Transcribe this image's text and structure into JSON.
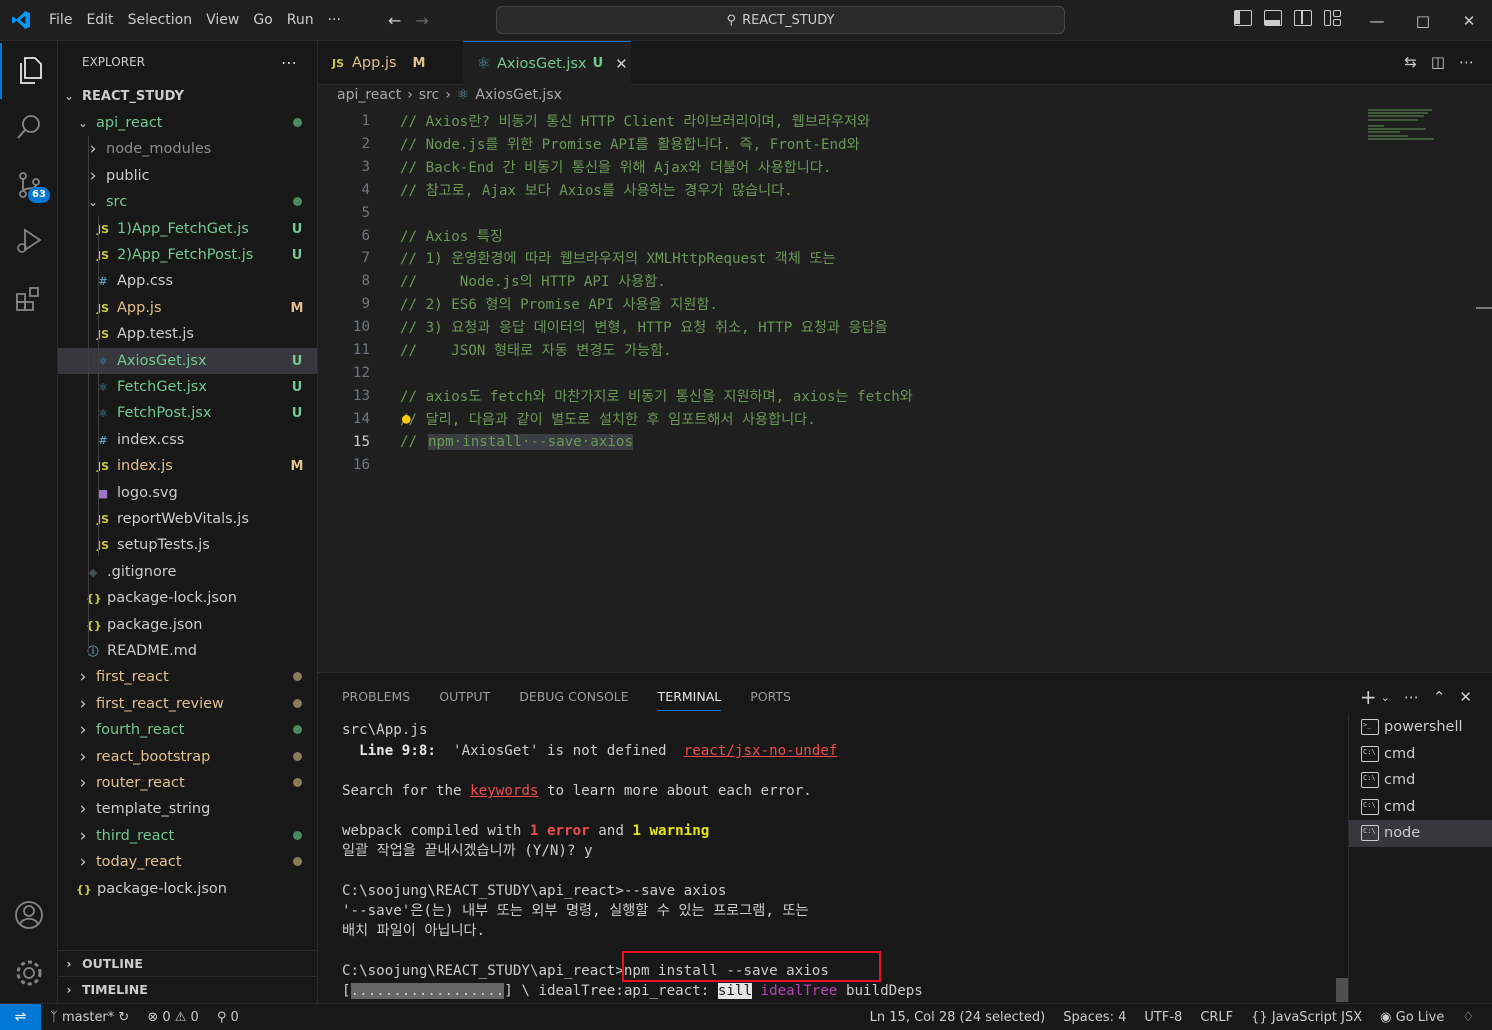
{
  "titlebar": {
    "menu": [
      "File",
      "Edit",
      "Selection",
      "View",
      "Go",
      "Run",
      "···"
    ],
    "search_text": "REACT_STUDY"
  },
  "activity": {
    "scm_badge": "63"
  },
  "explorer": {
    "header": "EXPLORER",
    "root": "REACT_STUDY",
    "items": [
      {
        "label": "api_react",
        "type": "folder",
        "state": "open",
        "color": "#73c991",
        "mark": "dot"
      },
      {
        "label": "node_modules",
        "type": "folder",
        "state": "closed",
        "color": "#8c8c8c",
        "mark": ""
      },
      {
        "label": "public",
        "type": "folder",
        "state": "closed",
        "color": "#cccccc",
        "mark": ""
      },
      {
        "label": "src",
        "type": "folder",
        "state": "open",
        "color": "#73c991",
        "mark": "dot"
      },
      {
        "label": "1)App_FetchGet.js",
        "type": "js",
        "color": "#73c991",
        "mark": "U"
      },
      {
        "label": "2)App_FetchPost.js",
        "type": "js",
        "color": "#73c991",
        "mark": "U"
      },
      {
        "label": "App.css",
        "type": "css",
        "color": "#cccccc",
        "mark": ""
      },
      {
        "label": "App.js",
        "type": "js",
        "color": "#e2c08d",
        "mark": "M"
      },
      {
        "label": "App.test.js",
        "type": "js",
        "color": "#cccccc",
        "mark": ""
      },
      {
        "label": "AxiosGet.jsx",
        "type": "jsx",
        "color": "#73c991",
        "mark": "U"
      },
      {
        "label": "FetchGet.jsx",
        "type": "jsx",
        "color": "#73c991",
        "mark": "U"
      },
      {
        "label": "FetchPost.jsx",
        "type": "jsx",
        "color": "#73c991",
        "mark": "U"
      },
      {
        "label": "index.css",
        "type": "css",
        "color": "#cccccc",
        "mark": ""
      },
      {
        "label": "index.js",
        "type": "js",
        "color": "#e2c08d",
        "mark": "M"
      },
      {
        "label": "logo.svg",
        "type": "svg",
        "color": "#cccccc",
        "mark": ""
      },
      {
        "label": "reportWebVitals.js",
        "type": "js",
        "color": "#cccccc",
        "mark": ""
      },
      {
        "label": "setupTests.js",
        "type": "js",
        "color": "#cccccc",
        "mark": ""
      },
      {
        "label": ".gitignore",
        "type": "git",
        "color": "#cccccc",
        "mark": ""
      },
      {
        "label": "package-lock.json",
        "type": "json",
        "color": "#cccccc",
        "mark": ""
      },
      {
        "label": "package.json",
        "type": "json",
        "color": "#cccccc",
        "mark": ""
      },
      {
        "label": "README.md",
        "type": "info",
        "color": "#cccccc",
        "mark": ""
      },
      {
        "label": "first_react",
        "type": "folder",
        "state": "closed",
        "color": "#e2c08d",
        "mark": "dot"
      },
      {
        "label": "first_react_review",
        "type": "folder",
        "state": "closed",
        "color": "#e2c08d",
        "mark": "dot"
      },
      {
        "label": "fourth_react",
        "type": "folder",
        "state": "closed",
        "color": "#73c991",
        "mark": "dot"
      },
      {
        "label": "react_bootstrap",
        "type": "folder",
        "state": "closed",
        "color": "#e2c08d",
        "mark": "dot"
      },
      {
        "label": "router_react",
        "type": "folder",
        "state": "closed",
        "color": "#e2c08d",
        "mark": "dot"
      },
      {
        "label": "template_string",
        "type": "folder",
        "state": "closed",
        "color": "#cccccc",
        "mark": ""
      },
      {
        "label": "third_react",
        "type": "folder",
        "state": "closed",
        "color": "#73c991",
        "mark": "dot"
      },
      {
        "label": "today_react",
        "type": "folder",
        "state": "closed",
        "color": "#e2c08d",
        "mark": "dot"
      },
      {
        "label": "package-lock.json",
        "type": "json",
        "color": "#cccccc",
        "mark": ""
      }
    ],
    "outline": "OUTLINE",
    "timeline": "TIMELINE"
  },
  "tabs": [
    {
      "label": "App.js",
      "badge": "M",
      "icon": "JS"
    },
    {
      "label": "AxiosGet.jsx",
      "badge": "U",
      "icon": "⚛"
    }
  ],
  "breadcrumb": [
    "api_react",
    "src",
    "AxiosGet.jsx"
  ],
  "code": {
    "current_line": 15,
    "lines": [
      "// Axios란? 비동기 통신 HTTP Client 라이브러리이며, 웹브라우저와",
      "// Node.js를 위한 Promise API를 활용합니다. 즉, Front-End와",
      "// Back-End 간 비동기 통신을 위해 Ajax와 더불어 사용합니다.",
      "// 참고로, Ajax 보다 Axios를 사용하는 경우가 많습니다.",
      "",
      "// Axios 특징",
      "// 1) 운영환경에 따라 웹브라우저의 XMLHttpRequest 객체 또는",
      "//     Node.js의 HTTP API 사용함.",
      "// 2) ES6 형의 Promise API 사용을 지원함.",
      "// 3) 요청과 응답 데이터의 변형, HTTP 요청 취소, HTTP 요청과 응답을",
      "//    JSON 형태로 자동 변경도 가능함.",
      "",
      "// axios도 fetch와 마찬가지로 비동기 통신을 지원하며, axios는 fetch와",
      "// 달리, 다음과 같이 별도로 설치한 후 임포트해서 사용합니다.",
      "// ",
      ""
    ],
    "selection_text": "npm·install·--save·axios"
  },
  "panel": {
    "tabs": [
      "PROBLEMS",
      "OUTPUT",
      "DEBUG CONSOLE",
      "TERMINAL",
      "PORTS"
    ],
    "active_tab": "TERMINAL",
    "terminal": {
      "t1": "src\\App.js",
      "t2_a": "  Line 9:8:",
      "t2_b": "  'AxiosGet' is not defined  ",
      "t2_c": "react/jsx-no-undef",
      "t3_a": "Search for the ",
      "t3_b": "keywords",
      "t3_c": " to learn more about each error.",
      "t4_a": "webpack compiled with ",
      "t4_b": "1 error",
      "t4_c": " and ",
      "t4_d": "1 warning",
      "t5": "일괄 작업을 끝내시겠습니까 (Y/N)? y",
      "t6": "C:\\soojung\\REACT_STUDY\\api_react>--save axios",
      "t7": "'--save'은(는) 내부 또는 외부 명령, 실행할 수 있는 프로그램, 또는",
      "t8": "배치 파일이 아닙니다.",
      "t9": "C:\\soojung\\REACT_STUDY\\api_react>npm install --save axios",
      "t10_a": "[",
      "t10_b": "..................",
      "t10_c": "] \\ idealTree:api_react: ",
      "t10_d": "sill",
      "t10_e": " idealTree",
      "t10_f": " buildDeps"
    },
    "terminal_list": [
      "powershell",
      "cmd",
      "cmd",
      "cmd",
      "node"
    ]
  },
  "status": {
    "branch": "master*",
    "errors": "0",
    "warnings": "0",
    "ports": "0",
    "position": "Ln 15, Col 28 (24 selected)",
    "spaces": "Spaces: 4",
    "encoding": "UTF-8",
    "eol": "CRLF",
    "language": "JavaScript JSX",
    "golive": "Go Live"
  },
  "colors": {
    "accent": "#0078d4",
    "untracked": "#73c991",
    "modified": "#e2c08d",
    "comment": "#6a9955"
  }
}
